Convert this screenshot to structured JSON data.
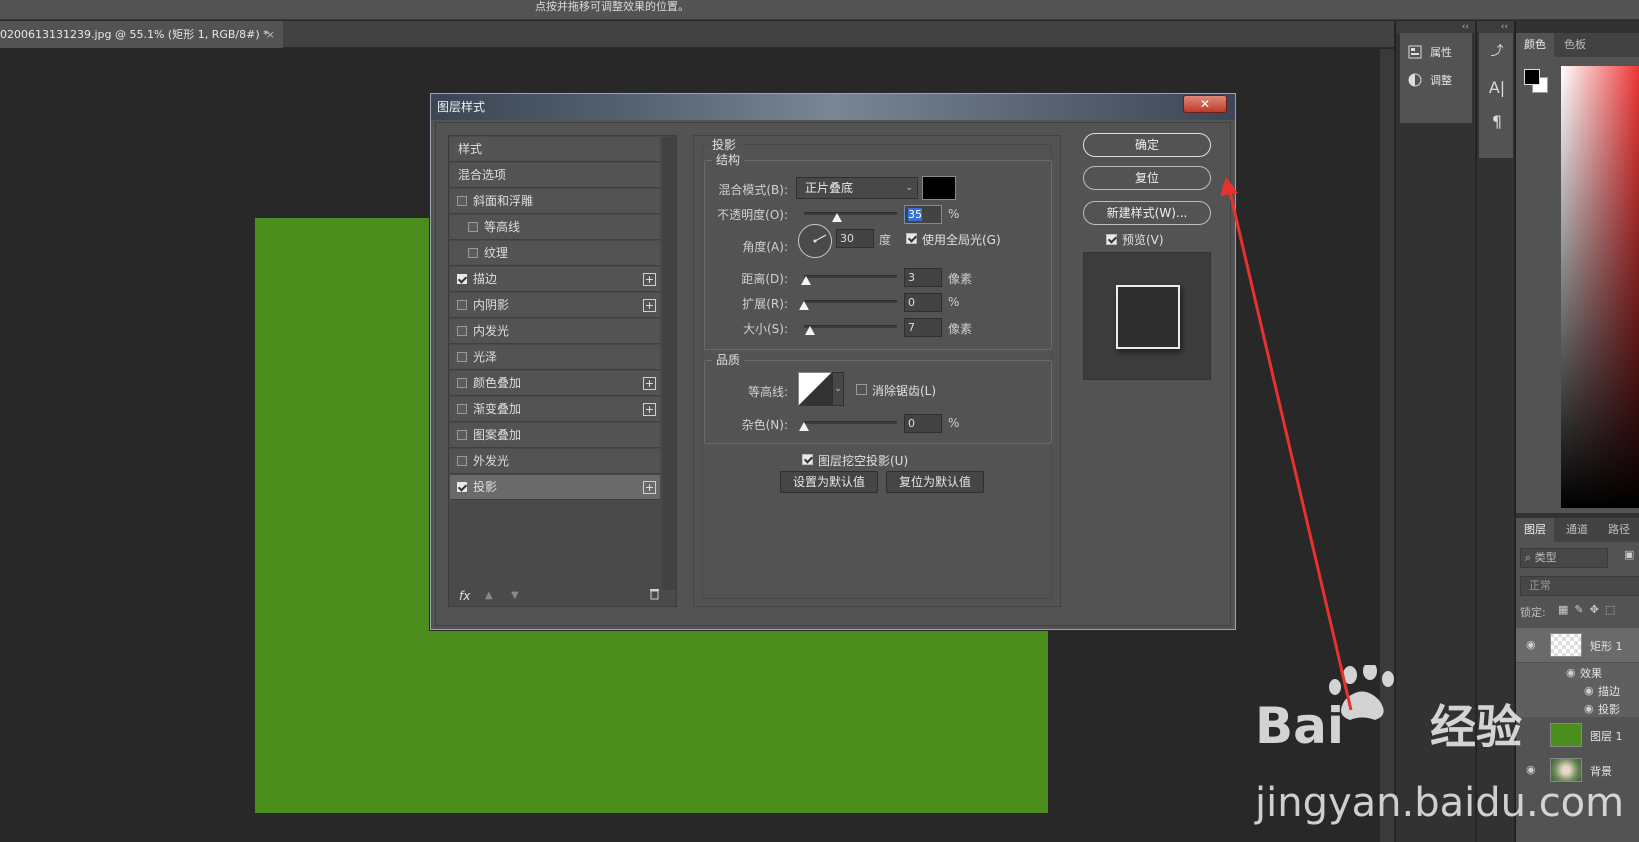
{
  "options_bar": {
    "hint": "点按并拖移可调整效果的位置。"
  },
  "document_tab": {
    "title": "0200613131239.jpg @ 55.1% (矩形 1, RGB/8#) *",
    "close": "×"
  },
  "panels_a": {
    "collapse": "‹‹",
    "items": [
      {
        "label": "属性",
        "icon": "properties-icon"
      },
      {
        "label": "调整",
        "icon": "adjustments-icon"
      }
    ]
  },
  "panels_b": {
    "collapse": "‹‹",
    "icons": [
      "history-icon",
      "character-icon",
      "paragraph-icon"
    ]
  },
  "color_panel": {
    "tabs": [
      "颜色",
      "色板"
    ],
    "fg_color": "#000000",
    "bg_color": "#ffffff"
  },
  "layers_panel": {
    "tabs": [
      "图层",
      "通道",
      "路径"
    ],
    "filter_placeholder": "类型",
    "blend_mode": "正常",
    "lock_label": "锁定:",
    "layers": [
      {
        "name": "矩形 1",
        "visible": true
      },
      {
        "name": "效果",
        "visible": true
      },
      {
        "name": "描边",
        "visible": true
      },
      {
        "name": "投影",
        "visible": true
      },
      {
        "name": "图层 1",
        "visible": false
      },
      {
        "name": "背景",
        "visible": true
      }
    ]
  },
  "dialog": {
    "title": "图层样式",
    "close": "✕",
    "styles": [
      {
        "label": "样式",
        "checkbox": false,
        "checked": false,
        "plus": false,
        "indent": false
      },
      {
        "label": "混合选项",
        "checkbox": false,
        "checked": false,
        "plus": false,
        "indent": false
      },
      {
        "label": "斜面和浮雕",
        "checkbox": true,
        "checked": false,
        "plus": false,
        "indent": false
      },
      {
        "label": "等高线",
        "checkbox": true,
        "checked": false,
        "plus": false,
        "indent": true
      },
      {
        "label": "纹理",
        "checkbox": true,
        "checked": false,
        "plus": false,
        "indent": true
      },
      {
        "label": "描边",
        "checkbox": true,
        "checked": true,
        "plus": true,
        "indent": false
      },
      {
        "label": "内阴影",
        "checkbox": true,
        "checked": false,
        "plus": true,
        "indent": false
      },
      {
        "label": "内发光",
        "checkbox": true,
        "checked": false,
        "plus": false,
        "indent": false
      },
      {
        "label": "光泽",
        "checkbox": true,
        "checked": false,
        "plus": false,
        "indent": false
      },
      {
        "label": "颜色叠加",
        "checkbox": true,
        "checked": false,
        "plus": true,
        "indent": false
      },
      {
        "label": "渐变叠加",
        "checkbox": true,
        "checked": false,
        "plus": true,
        "indent": false
      },
      {
        "label": "图案叠加",
        "checkbox": true,
        "checked": false,
        "plus": false,
        "indent": false
      },
      {
        "label": "外发光",
        "checkbox": true,
        "checked": false,
        "plus": false,
        "indent": false
      },
      {
        "label": "投影",
        "checkbox": true,
        "checked": true,
        "plus": true,
        "indent": false,
        "selected": true
      }
    ],
    "footer": {
      "fx": "fx",
      "up": "▲",
      "down": "▼",
      "trash": "🗑"
    },
    "drop_shadow": {
      "group_title": "投影",
      "structure": {
        "title": "结构",
        "blend_mode_label": "混合模式(B):",
        "blend_mode_value": "正片叠底",
        "shadow_color": "#000000",
        "opacity_label": "不透明度(O):",
        "opacity_value": "35",
        "opacity_fraction": 0.35,
        "percent": "%",
        "angle_label": "角度(A):",
        "angle_value": "30",
        "angle_unit": "度",
        "global_light_label": "使用全局光(G)",
        "global_light_checked": true,
        "distance_label": "距离(D):",
        "distance_value": "3",
        "distance_unit": "像素",
        "spread_label": "扩展(R):",
        "spread_value": "0",
        "size_label": "大小(S):",
        "size_value": "7",
        "size_unit": "像素"
      },
      "quality": {
        "title": "品质",
        "contour_label": "等高线:",
        "antialias_label": "消除锯齿(L)",
        "antialias_checked": false,
        "noise_label": "杂色(N):",
        "noise_value": "0"
      },
      "knockout_label": "图层挖空投影(U)",
      "knockout_checked": true,
      "set_default": "设置为默认值",
      "reset_default": "复位为默认值"
    },
    "buttons": {
      "ok": "确定",
      "reset": "复位",
      "new_style": "新建样式(W)...",
      "preview_label": "预览(V)",
      "preview_checked": true
    }
  },
  "watermark": {
    "text": "jingyan.baidu.com",
    "logo": "Bai 经验"
  },
  "colors": {
    "canvas_fill": "#4b8e1e",
    "annotation_arrow": "#e8322e"
  }
}
